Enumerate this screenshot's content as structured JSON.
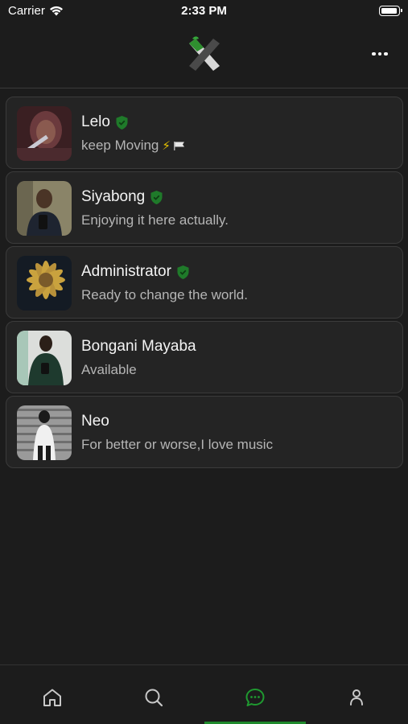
{
  "status_bar": {
    "carrier": "Carrier",
    "time": "2:33 PM"
  },
  "header": {
    "logo_icon": "app-x-logo-icon",
    "more_icon": "more-dots-icon"
  },
  "chats": [
    {
      "name": "Lelo",
      "status": "keep Moving",
      "verified": true,
      "status_suffix": "⚡",
      "has_flag": true
    },
    {
      "name": "Siyabong",
      "status": "Enjoying it here actually.",
      "verified": true
    },
    {
      "name": "Administrator",
      "status": "Ready to change the world.",
      "verified": true
    },
    {
      "name": "Bongani Mayaba",
      "status": "Available",
      "verified": false
    },
    {
      "name": "Neo",
      "status": "For better or worse,I love music",
      "verified": false
    }
  ],
  "tabs": [
    {
      "icon": "home-icon",
      "active": false
    },
    {
      "icon": "search-icon",
      "active": false
    },
    {
      "icon": "chat-bubble-icon",
      "active": true
    },
    {
      "icon": "profile-icon",
      "active": false
    }
  ],
  "colors": {
    "accent": "#1f8a2c",
    "background": "#1c1c1c",
    "card": "#242424",
    "verified": "#1f7a2a"
  }
}
